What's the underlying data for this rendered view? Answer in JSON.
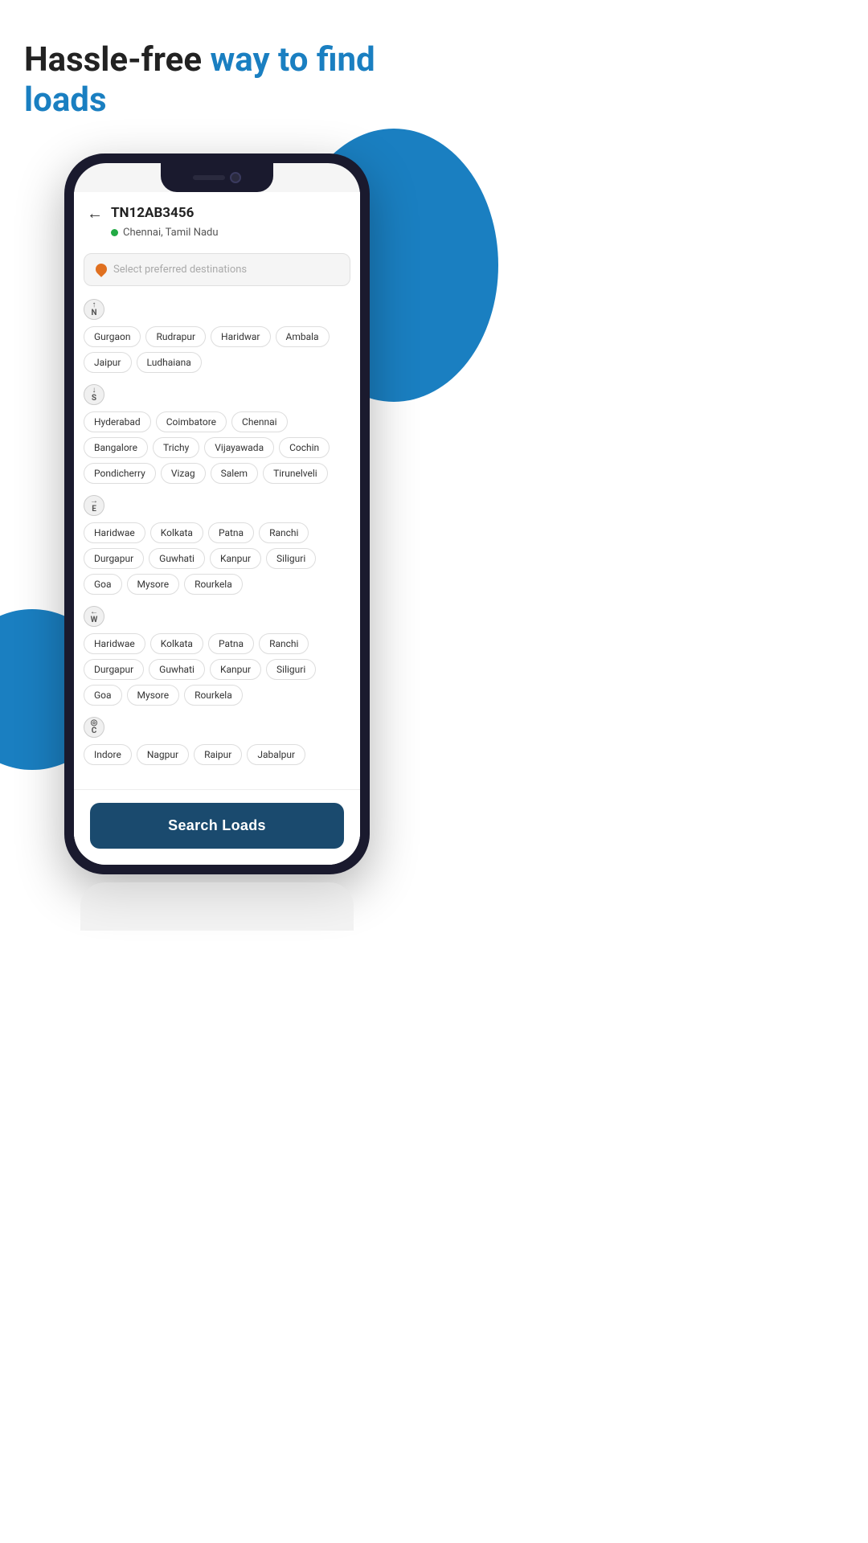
{
  "page": {
    "hero": {
      "prefix": "Hassle-free ",
      "highlight": "way to find loads"
    },
    "circles": {
      "top_right": true,
      "bottom_left": true
    }
  },
  "phone": {
    "vehicle_id": "TN12AB3456",
    "location": "Chennai, Tamil Nadu",
    "search_placeholder": "Select preferred destinations",
    "back_label": "←",
    "directions": [
      {
        "id": "north",
        "badge_line1": "↑",
        "badge_line2": "N",
        "chips": [
          "Gurgaon",
          "Rudrapur",
          "Haridwar",
          "Ambala",
          "Jaipur",
          "Ludhaiana"
        ]
      },
      {
        "id": "south",
        "badge_line1": "↓",
        "badge_line2": "S",
        "chips": [
          "Hyderabad",
          "Coimbatore",
          "Chennai",
          "Bangalore",
          "Trichy",
          "Vijayawada",
          "Cochin",
          "Pondicherry",
          "Vizag",
          "Salem",
          "Tirunelveli"
        ]
      },
      {
        "id": "east",
        "badge_line1": "→",
        "badge_line2": "E",
        "chips": [
          "Haridwae",
          "Kolkata",
          "Patna",
          "Ranchi",
          "Durgapur",
          "Guwhati",
          "Kanpur",
          "Siliguri",
          "Goa",
          "Mysore",
          "Rourkela"
        ]
      },
      {
        "id": "west",
        "badge_line1": "←",
        "badge_line2": "W",
        "chips": [
          "Haridwae",
          "Kolkata",
          "Patna",
          "Ranchi",
          "Durgapur",
          "Guwhati",
          "Kanpur",
          "Siliguri",
          "Goa",
          "Mysore",
          "Rourkela"
        ]
      },
      {
        "id": "central",
        "badge_line1": "◎",
        "badge_line2": "C",
        "chips": [
          "Indore",
          "Nagpur",
          "Raipur",
          "Jabalpur"
        ]
      }
    ],
    "search_button_label": "Search Loads"
  }
}
